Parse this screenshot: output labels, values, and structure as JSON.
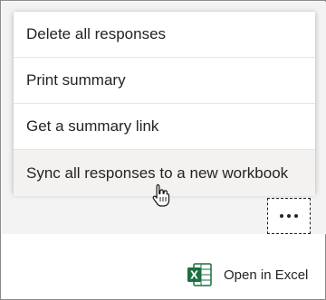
{
  "menu": {
    "items": [
      {
        "label": "Delete all responses"
      },
      {
        "label": "Print summary"
      },
      {
        "label": "Get a summary link"
      },
      {
        "label": "Sync all responses to a new workbook"
      }
    ]
  },
  "more_button": {
    "icon": "more-horizontal-icon"
  },
  "open_in_excel": {
    "label": "Open in Excel",
    "icon": "excel-icon",
    "brand_color": "#1d6f42"
  },
  "cursor": {
    "icon": "hand-pointer-icon"
  }
}
